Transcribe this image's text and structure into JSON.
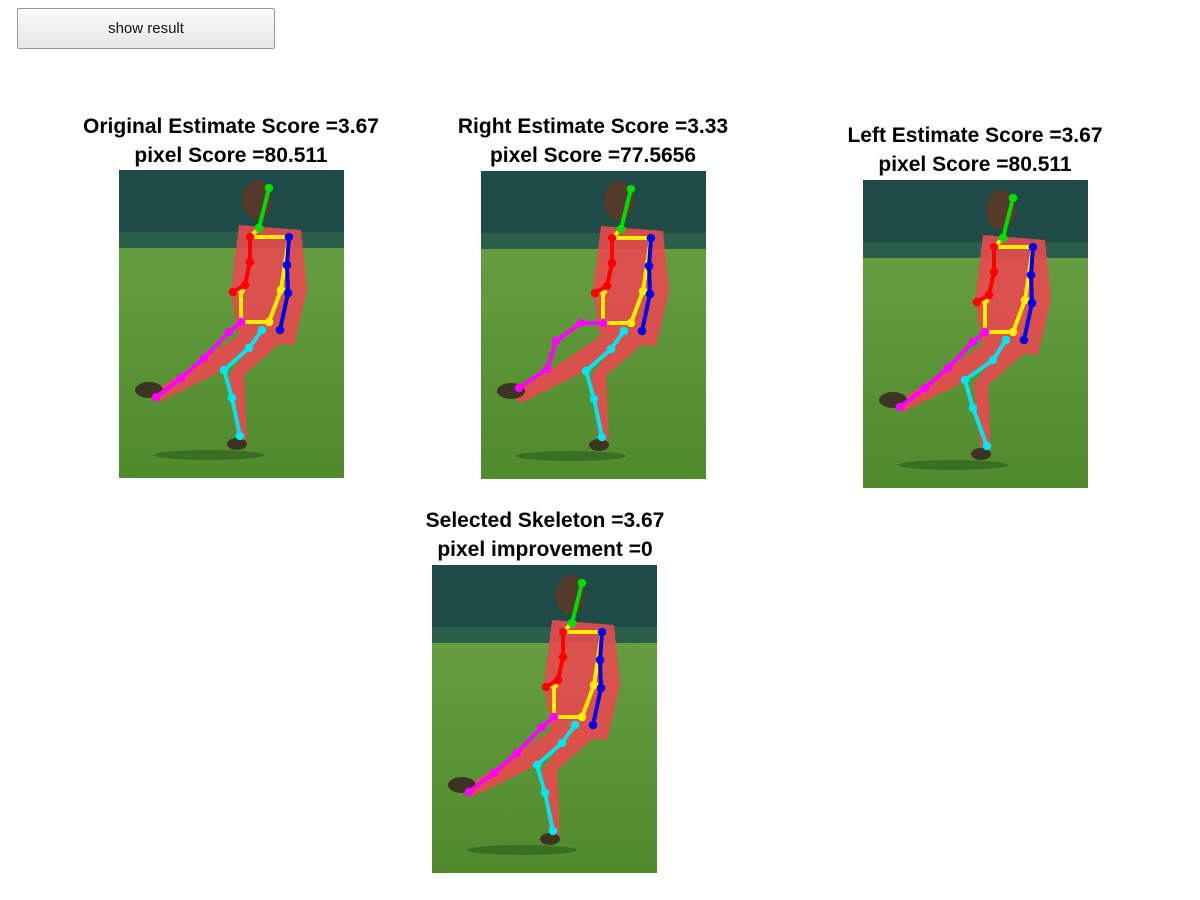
{
  "button": {
    "label": "show result"
  },
  "panels": [
    {
      "id": "original",
      "title": "Original Estimate Score =3.67",
      "subtitle": "pixel Score =80.511"
    },
    {
      "id": "right",
      "title": "Right Estimate Score =3.33",
      "subtitle": "pixel Score =77.5656"
    },
    {
      "id": "left",
      "title": "Left Estimate Score =3.67",
      "subtitle": "pixel Score =80.511"
    },
    {
      "id": "selected",
      "title": "Selected Skeleton =3.67",
      "subtitle": "pixel improvement =0"
    }
  ],
  "colors": {
    "head": "#00dd00",
    "torso": "#ffee00",
    "right_arm": "#ff0000",
    "left_arm": "#0000ee",
    "right_leg": "#ff00ff",
    "left_leg": "#00e5ee",
    "grass": "#4f8a2c",
    "wall": "#1e4a48",
    "player": "#e84a4f"
  }
}
